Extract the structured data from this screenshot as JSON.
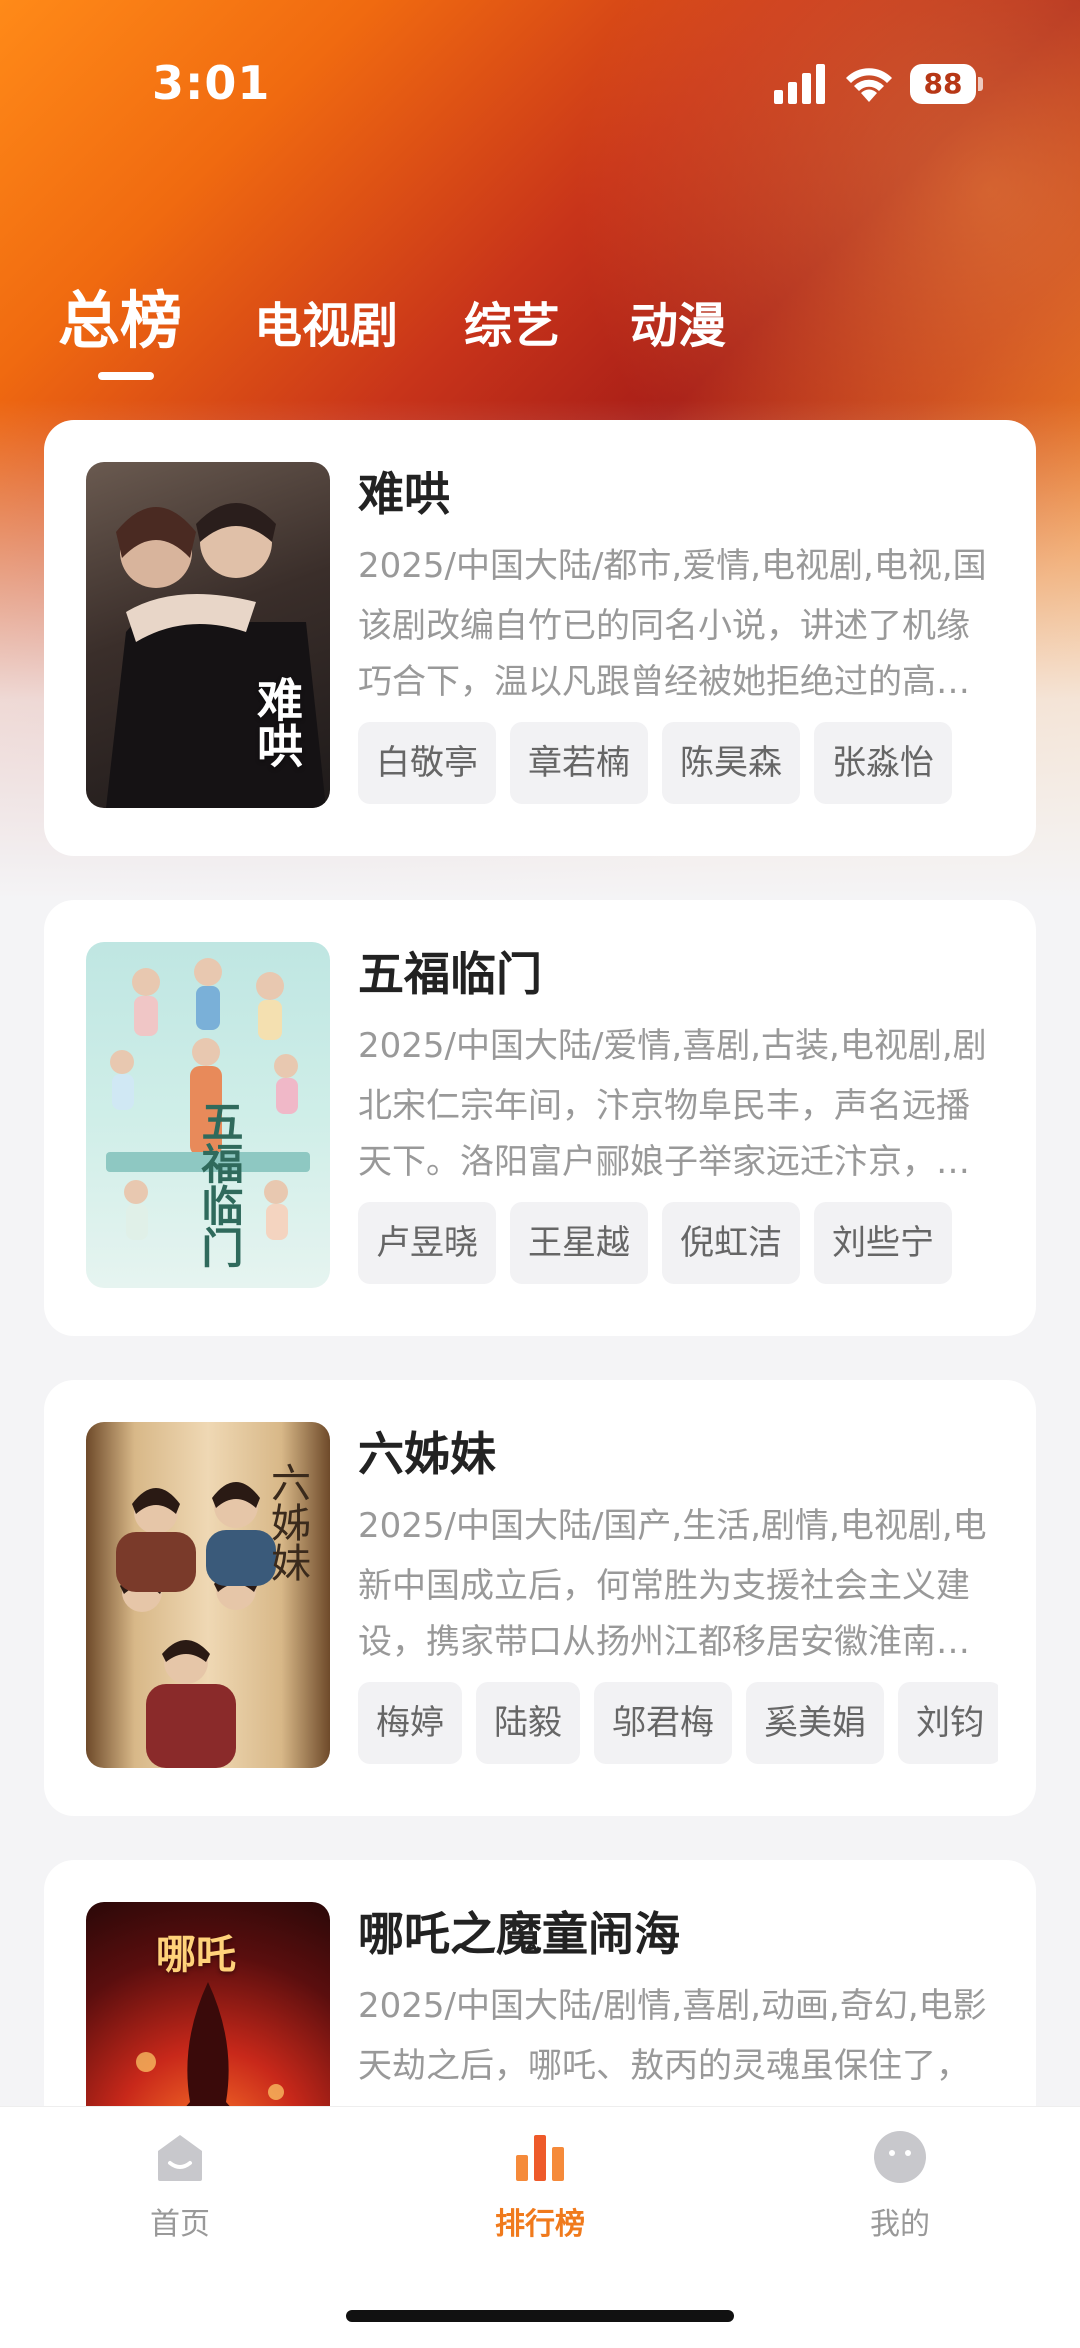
{
  "status_bar": {
    "time": "3:01",
    "battery": "88"
  },
  "tabs": [
    {
      "label": "总榜",
      "active": true
    },
    {
      "label": "电视剧",
      "active": false
    },
    {
      "label": "综艺",
      "active": false
    },
    {
      "label": "动漫",
      "active": false
    }
  ],
  "items": [
    {
      "title": "难哄",
      "meta": "2025/中国大陆/都市,爱情,电视剧,电视,国",
      "description": "该剧改编自竹已的同名小说，讲述了机缘巧合下，温以凡跟曾经被她拒绝过的高…",
      "poster_text": "难哄",
      "cast": [
        "白敬亭",
        "章若楠",
        "陈昊森",
        "张淼怡"
      ]
    },
    {
      "title": "五福临门",
      "meta": "2025/中国大陆/爱情,喜剧,古装,电视剧,剧",
      "description": "北宋仁宗年间，汴京物阜民丰，声名远播天下。洛阳富户郦娘子举家远迁汴京，…",
      "poster_text": "五福临门",
      "cast": [
        "卢昱晓",
        "王星越",
        "倪虹洁",
        "刘些宁"
      ]
    },
    {
      "title": "六姊妹",
      "meta": "2025/中国大陆/国产,生活,剧情,电视剧,电",
      "description": "新中国成立后，何常胜为支援社会主义建设，携家带口从扬州江都移居安徽淮南…",
      "poster_text": "六姊妹",
      "cast": [
        "梅婷",
        "陆毅",
        "邬君梅",
        "奚美娟",
        "刘钧"
      ]
    },
    {
      "title": "哪吒之魔童闹海",
      "meta": "2025/中国大陆/剧情,喜剧,动画,奇幻,电影",
      "description": "天劫之后，哪吒、敖丙的灵魂虽保住了，",
      "poster_text": "哪吒",
      "cast": []
    }
  ],
  "bottom_nav": [
    {
      "label": "首页",
      "icon": "home-icon",
      "active": false
    },
    {
      "label": "排行榜",
      "icon": "ranking-icon",
      "active": true
    },
    {
      "label": "我的",
      "icon": "profile-icon",
      "active": false
    }
  ],
  "colors": {
    "accent": "#f07a1c",
    "header_orange": "#ff8a18",
    "header_red": "#a81e18"
  }
}
